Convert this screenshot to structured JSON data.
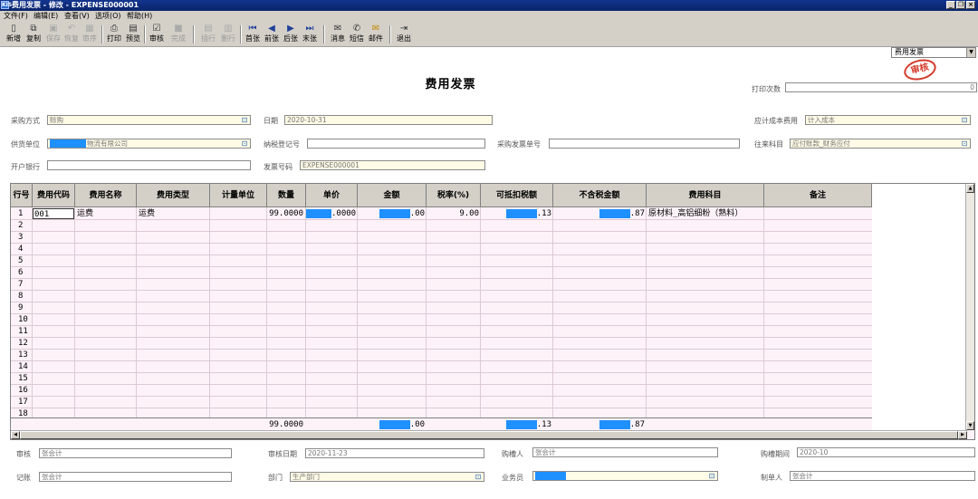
{
  "window": {
    "title": "费用发票 - 修改 - EXPENSE000001",
    "app_icon": "KIS",
    "buttons": [
      "_",
      "❐",
      "×"
    ]
  },
  "menu": [
    "文件(F)",
    "编辑(E)",
    "查看(V)",
    "选项(O)",
    "帮助(H)"
  ],
  "toolbar": {
    "buttons": [
      {
        "label": "新增",
        "icon": "new-doc-icon",
        "enabled": true
      },
      {
        "label": "复制",
        "icon": "copy-icon",
        "enabled": true
      },
      {
        "label": "保存",
        "icon": "save-icon",
        "enabled": false
      },
      {
        "label": "恢复",
        "icon": "undo-icon",
        "enabled": false
      },
      {
        "label": "审序",
        "icon": "sequence-icon",
        "enabled": false
      },
      {
        "label": "打印",
        "icon": "print-icon",
        "enabled": true
      },
      {
        "label": "预览",
        "icon": "preview-icon",
        "enabled": true
      },
      {
        "label": "审核",
        "icon": "audit-icon",
        "enabled": true
      },
      {
        "label": "完成",
        "icon": "finish-icon",
        "enabled": false
      },
      {
        "label": "插行",
        "icon": "insert-row-icon",
        "enabled": false
      },
      {
        "label": "删行",
        "icon": "delete-row-icon",
        "enabled": false
      },
      {
        "label": "首张",
        "icon": "first-icon",
        "enabled": true
      },
      {
        "label": "前张",
        "icon": "prev-icon",
        "enabled": true
      },
      {
        "label": "后张",
        "icon": "next-icon",
        "enabled": true
      },
      {
        "label": "末张",
        "icon": "last-icon",
        "enabled": true
      },
      {
        "label": "消息",
        "icon": "message-icon",
        "enabled": true
      },
      {
        "label": "短信",
        "icon": "sms-icon",
        "enabled": true
      },
      {
        "label": "邮件",
        "icon": "mail-icon",
        "enabled": true
      },
      {
        "label": "退出",
        "icon": "exit-icon",
        "enabled": true
      }
    ],
    "doc_type_select": "费用发票"
  },
  "doc": {
    "title": "费用发票",
    "stamp": "审核"
  },
  "header": {
    "print_count": {
      "label": "打印次数",
      "value": "0"
    },
    "purchase_method": {
      "label": "采购方式",
      "value": "赊购"
    },
    "date": {
      "label": "日期",
      "value": "2020-10-31"
    },
    "cost_account": {
      "label": "应计成本费用",
      "value": "计入成本"
    },
    "supplier": {
      "label": "供货单位",
      "value": "物流有限公司"
    },
    "tax_reg_no": {
      "label": "纳税登记号",
      "value": ""
    },
    "purchase_invoice_no": {
      "label": "采购发票单号",
      "value": ""
    },
    "contact_account": {
      "label": "往来科目",
      "value": "应付账款_财务应付"
    },
    "bank": {
      "label": "开户银行",
      "value": ""
    },
    "invoice_no": {
      "label": "发票号码",
      "value": "EXPENSE000001"
    }
  },
  "grid": {
    "columns": [
      "行号",
      "费用代码",
      "费用名称",
      "费用类型",
      "计量单位",
      "数量",
      "单价",
      "金额",
      "税率(%)",
      "可抵扣税额",
      "不含税金额",
      "费用科目",
      "备注"
    ],
    "row_numbers": [
      "1",
      "2",
      "3",
      "4",
      "5",
      "6",
      "7",
      "8",
      "9",
      "10",
      "11",
      "12",
      "13",
      "14",
      "15",
      "16",
      "17",
      "18"
    ],
    "row1": {
      "code": "001",
      "name": "运费",
      "type": "运费",
      "unit": "",
      "qty": "99.0000",
      "price_tail": ".0000",
      "amount_tail": ".00",
      "tax_rate": "9.00",
      "deductible_tail": ".13",
      "net_tail": ".87",
      "subject": "原材料_高铝细粉（熟料）",
      "remark": ""
    },
    "totals": {
      "qty": "99.0000",
      "amount_tail": ".00",
      "deductible_tail": ".13",
      "net_tail": ".87"
    }
  },
  "footer": {
    "reviewer": {
      "label": "审核",
      "value": "张会计"
    },
    "review_date": {
      "label": "审核日期",
      "value": "2020-11-23"
    },
    "purchaser": {
      "label": "购槽人",
      "value": "张会计"
    },
    "period": {
      "label": "购槽期间",
      "value": "2020-10"
    },
    "bookkeeper": {
      "label": "记账",
      "value": "张会计"
    },
    "dept": {
      "label": "部门",
      "value": "生产部门"
    },
    "salesman": {
      "label": "业务员",
      "value": ""
    },
    "maker": {
      "label": "制单人",
      "value": "张会计"
    }
  },
  "colors": {
    "titlebar": "#0a246a",
    "chrome": "#d4d0c8",
    "grid_bg": "#fdf2f8",
    "field_yellow": "#fffbe6",
    "mask_blue": "#1e90ff",
    "stamp_red": "#d43a2a"
  }
}
